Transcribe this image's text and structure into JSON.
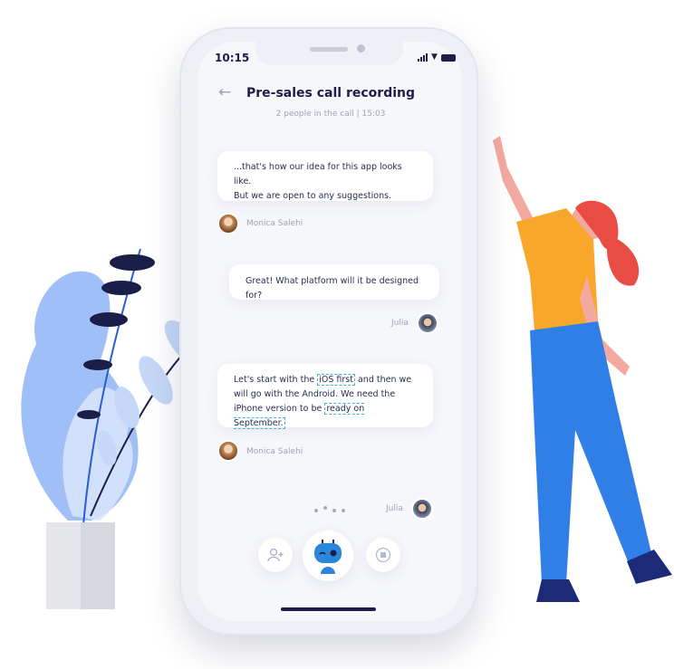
{
  "status_bar": {
    "time": "10:15"
  },
  "header": {
    "title": "Pre-sales call recording",
    "subtitle": "2 people in the call | 15:03"
  },
  "messages": [
    {
      "lines": [
        "...that's how our idea for this app looks like.",
        "But we are open to any suggestions."
      ],
      "author": "Monica Salehi"
    },
    {
      "text": "Great! What platform will it be designed for?",
      "author": "Julia"
    },
    {
      "parts": [
        "Let's start with the ",
        "iOS first",
        " and then we will go with the Android. We need the iPhone version to be ",
        "ready on September."
      ],
      "author": "Monica Salehi"
    }
  ],
  "typing": {
    "author": "Julia"
  },
  "controls": {
    "add_user": "user-plus-icon",
    "assistant": "bot-icon",
    "stop": "stop-icon"
  },
  "colors": {
    "accent": "#3bb6e0",
    "title": "#1c1e4a",
    "muted": "#9da2bb",
    "plant": "#7ea6f4",
    "shirt": "#f9a72b",
    "pants": "#2f7fe6",
    "hair": "#e94b45"
  }
}
